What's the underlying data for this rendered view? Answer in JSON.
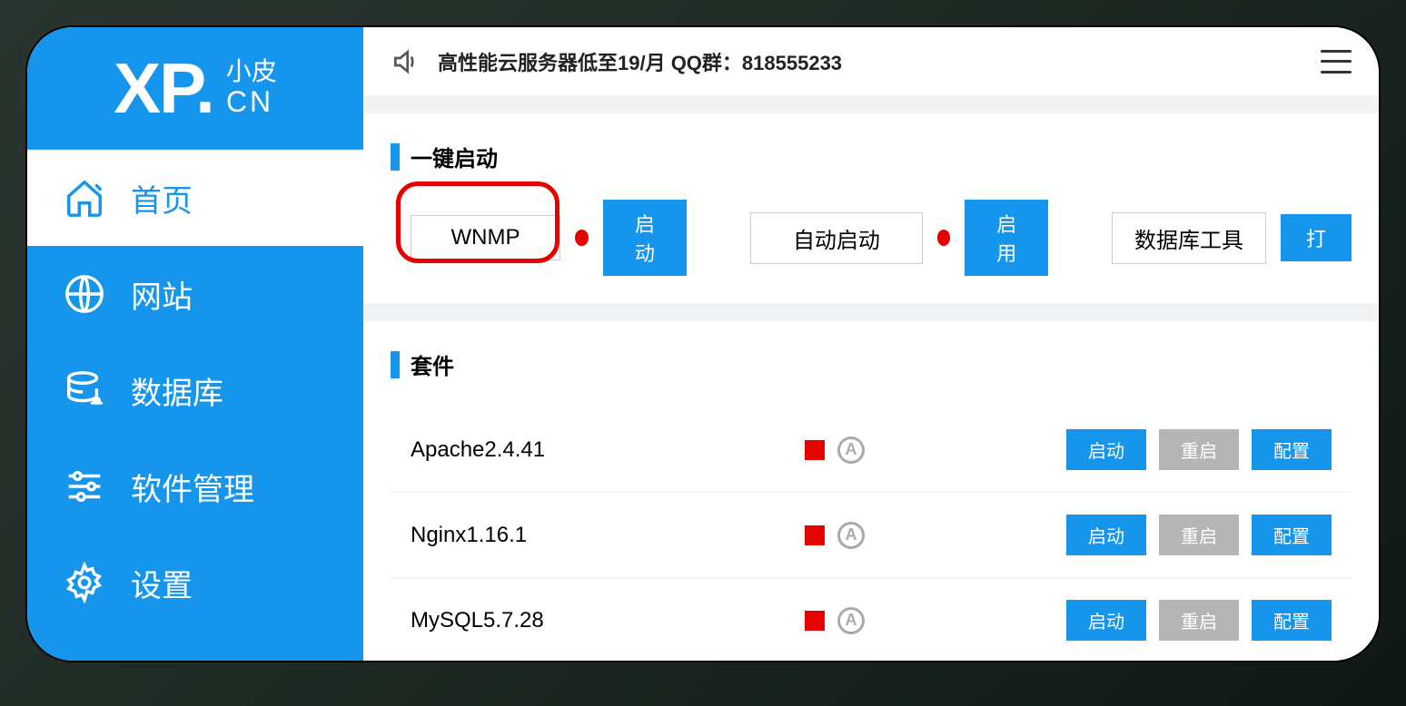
{
  "logo": {
    "xp": "XP.",
    "sub_top": "小皮",
    "sub_bot": "CN"
  },
  "sidebar": {
    "items": [
      {
        "label": "首页"
      },
      {
        "label": "网站"
      },
      {
        "label": "数据库"
      },
      {
        "label": "软件管理"
      },
      {
        "label": "设置"
      }
    ]
  },
  "topbar": {
    "announcement": "高性能云服务器低至19/月  QQ群：818555233"
  },
  "quick": {
    "title": "一键启动",
    "stack": {
      "label": "WNMP",
      "btn": "启动"
    },
    "autostart": {
      "label": "自动启动",
      "btn": "启用"
    },
    "dbtool": {
      "label": "数据库工具",
      "btn": "打"
    }
  },
  "services": {
    "title": "套件",
    "btns": {
      "start": "启动",
      "restart": "重启",
      "config": "配置"
    },
    "items": [
      {
        "name": "Apache2.4.41"
      },
      {
        "name": "Nginx1.16.1"
      },
      {
        "name": "MySQL5.7.28"
      }
    ]
  },
  "icon_label_a": "A"
}
